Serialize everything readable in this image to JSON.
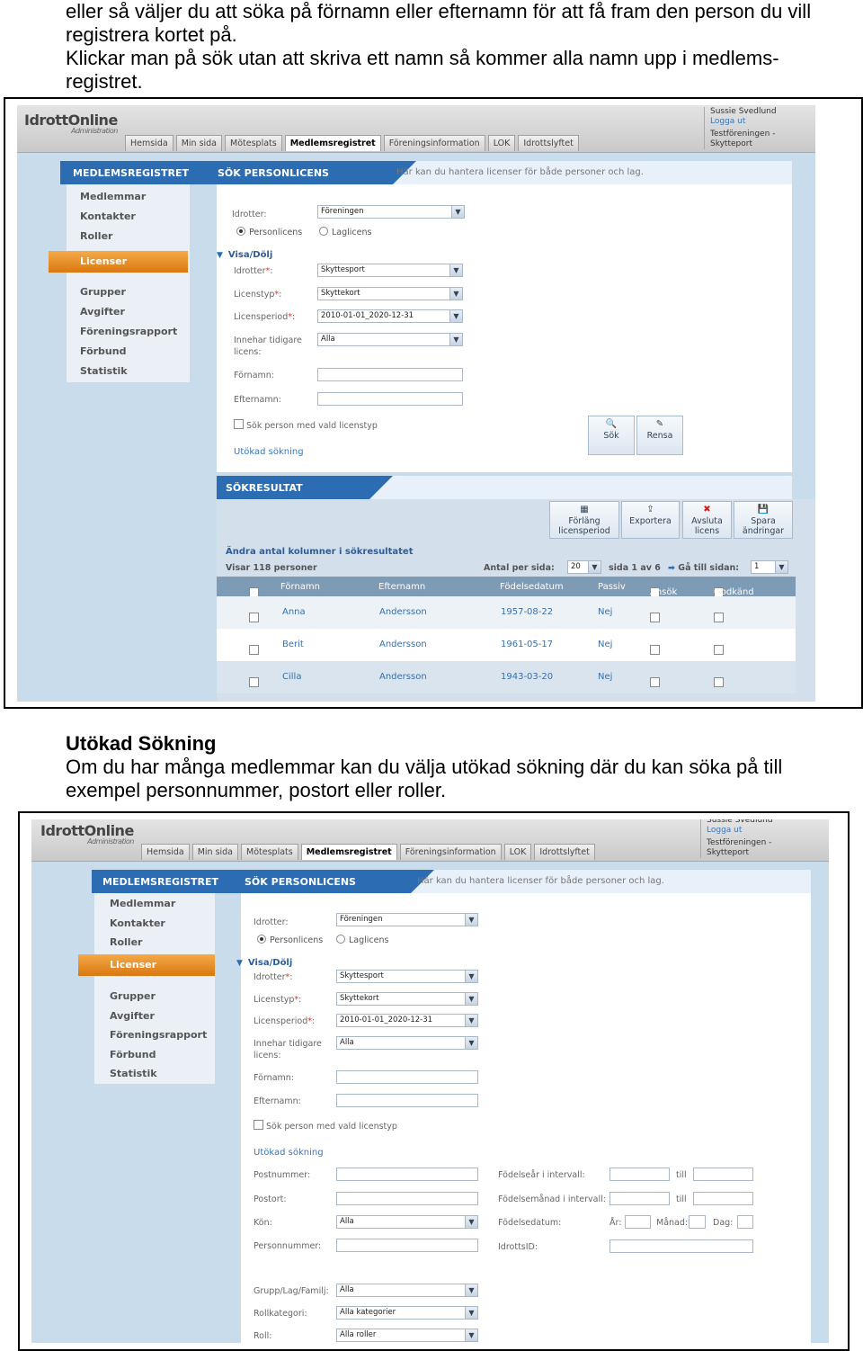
{
  "intro": {
    "lines": [
      "eller så väljer du att söka på förnamn eller efternamn för att få fram den person du vill",
      "registrera kortet på.",
      "Klickar man på sök utan att skriva ett namn så kommer alla namn upp i medlems-",
      "registret."
    ]
  },
  "section": {
    "heading": "Utökad Sökning",
    "lines": [
      "Om du har många medlemmar kan du välja utökad sökning där du kan söka på till",
      "exempel personnummer, postort eller roller."
    ]
  },
  "app": {
    "logo": "IdrottOnline",
    "logo_sub": "Administration",
    "user_name": "Sussie Svedlund",
    "logout": "Logga ut",
    "org_line1": "Testföreningen -",
    "org_line2": "Skytteport",
    "nav_tabs": [
      "Hemsida",
      "Min sida",
      "Mötesplats",
      "Medlemsregistret",
      "Föreningsinformation",
      "LOK",
      "Idrottslyftet"
    ],
    "section_title": "MEDLEMSREGISTRET",
    "page_title": "SÖK PERSONLICENS",
    "page_desc": "Här kan du hantera licenser för både personer och lag.",
    "sidebar": [
      "Medlemmar",
      "Kontakter",
      "Roller",
      "Licenser",
      "Grupper",
      "Avgifter",
      "Föreningsrapport",
      "Förbund",
      "Statistik"
    ],
    "form": {
      "idrotter_label": "Idrotter:",
      "idrotter_value": "Föreningen",
      "radio_person": "Personlicens",
      "radio_lag": "Laglicens",
      "toggle": "Visa/Dölj",
      "idrotter2_label": "Idrotter",
      "idrotter2_value": "Skyttesport",
      "licenstyp_label": "Licenstyp",
      "licenstyp_value": "Skyttekort",
      "licensperiod_label": "Licensperiod",
      "licensperiod_value": "2010-01-01_2020-12-31",
      "innehar_label_1": "Innehar tidigare",
      "innehar_label_2": "licens:",
      "innehar_value": "Alla",
      "fornamn_label": "Förnamn:",
      "efternamn_label": "Efternamn:",
      "sok_vald": "Sök person med vald licenstyp",
      "utokad": "Utökad sökning",
      "btn_sok": "Sök",
      "btn_rensa": "Rensa"
    },
    "results": {
      "title": "SÖKRESULTAT",
      "btn_forlang": [
        "Förläng",
        "licensperiod"
      ],
      "btn_exportera": "Exportera",
      "btn_avsluta": [
        "Avsluta",
        "licens"
      ],
      "btn_spara": [
        "Spara",
        "ändringar"
      ],
      "change_cols": "Ändra antal kolumner i sökresultatet",
      "showing": "Visar 118 personer",
      "per_page_label": "Antal per sida:",
      "per_page_value": "20",
      "page_info": "sida 1 av 6",
      "goto_label": "Gå till sidan:",
      "goto_value": "1",
      "columns": [
        "Förnamn",
        "Efternamn",
        "Födelsedatum",
        "Passiv",
        "Ansök",
        "Godkänd"
      ],
      "rows": [
        {
          "fornamn": "Anna",
          "efternamn": "Andersson",
          "fodd": "1957-08-22",
          "passiv": "Nej"
        },
        {
          "fornamn": "Berit",
          "efternamn": "Andersson",
          "fodd": "1961-05-17",
          "passiv": "Nej"
        },
        {
          "fornamn": "Cilla",
          "efternamn": "Andersson",
          "fodd": "1943-03-20",
          "passiv": "Nej"
        }
      ]
    },
    "extended": {
      "postnummer": "Postnummer:",
      "postort": "Postort:",
      "kon": "Kön:",
      "kon_value": "Alla",
      "personnummer": "Personnummer:",
      "fodelsear": "Födelseår i intervall:",
      "fodelsemanad": "Födelsemånad i intervall:",
      "fodelsedatum": "Födelsedatum:",
      "till": "till",
      "ar": "År:",
      "manad": "Månad:",
      "dag": "Dag:",
      "idrottsid": "IdrottsID:",
      "grupp_label": "Grupp/Lag/Familj:",
      "grupp_value": "Alla",
      "rollkategori_label": "Rollkategori:",
      "rollkategori_value": "Alla kategorier",
      "roll_label": "Roll:",
      "roll_value": "Alla roller"
    }
  }
}
